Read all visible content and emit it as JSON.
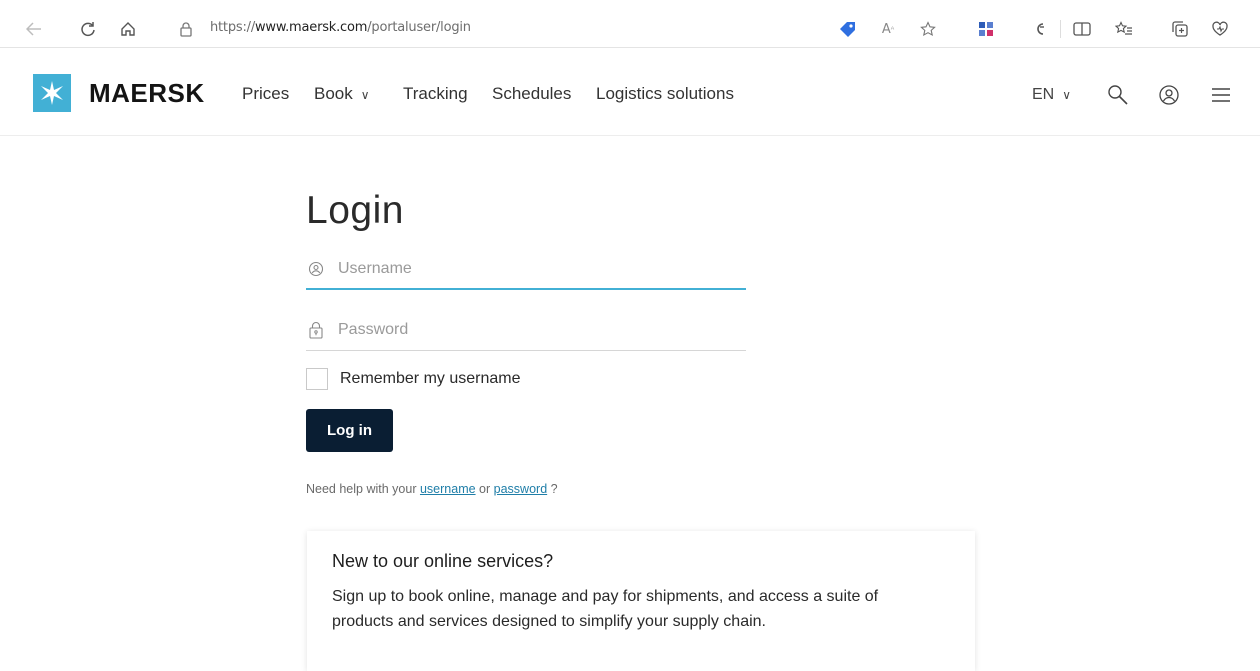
{
  "browser": {
    "url_scheme": "https://",
    "url_host": "www.maersk.com",
    "url_path": "/portaluser/login",
    "icons": [
      "back-arrow-icon",
      "refresh-icon",
      "home-icon",
      "lock-icon",
      "tag-icon",
      "read-aloud-icon",
      "favorite-star-icon",
      "extension-icon",
      "copilot-icon",
      "split-screen-icon",
      "favorites-icon",
      "collections-icon",
      "browser-essentials-icon"
    ]
  },
  "header": {
    "brand": "MAERSK",
    "nav": [
      {
        "label": "Prices"
      },
      {
        "label": "Book",
        "dropdown": true
      },
      {
        "label": "Tracking"
      },
      {
        "label": "Schedules"
      },
      {
        "label": "Logistics solutions"
      }
    ],
    "language": "EN",
    "icons": [
      "search-icon",
      "user-icon",
      "menu-icon"
    ]
  },
  "login": {
    "title": "Login",
    "username_placeholder": "Username",
    "password_placeholder": "Password",
    "remember_label": "Remember my username",
    "button_label": "Log in",
    "help_prefix": "Need help with your",
    "help_username": "username",
    "help_or": "or",
    "help_password": "password",
    "help_suffix": "?"
  },
  "signup_card": {
    "title": "New to our online services?",
    "body": "Sign up to book online, manage and pay for shipments, and access a suite of products and services designed to simplify your supply chain."
  },
  "colors": {
    "brand_blue": "#42b0d5",
    "button_navy": "#0a1e33",
    "link": "#1f7ea8"
  }
}
